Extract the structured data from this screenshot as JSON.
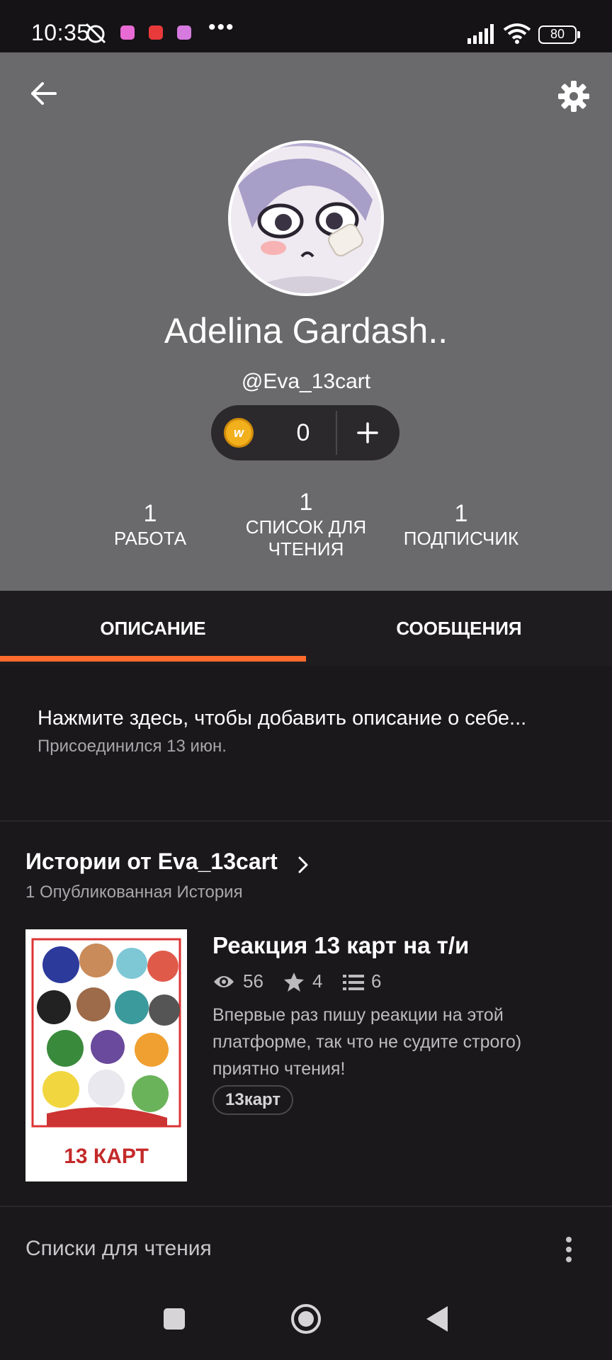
{
  "status_bar": {
    "time": "10:35",
    "battery": "80",
    "more": "•••",
    "icons": [
      "alarm-off-icon",
      "app-notification-icon",
      "yandex-icon",
      "app-icon",
      "signal-icon",
      "wifi-icon",
      "battery-icon"
    ]
  },
  "header": {
    "back_icon": "arrow-left-icon",
    "settings_icon": "gear-icon",
    "name": "Adelina Gardash..",
    "handle": "@Eva_13cart",
    "coins": {
      "icon": "wattpad-coin-icon",
      "coin_letter": "w",
      "count": "0",
      "add_icon": "plus-icon"
    },
    "stats": [
      {
        "value": "1",
        "label_lines": [
          "РАБОТА"
        ]
      },
      {
        "value": "1",
        "label_lines": [
          "СПИСОК ДЛЯ",
          "ЧТЕНИЯ"
        ]
      },
      {
        "value": "1",
        "label_lines": [
          "ПОДПИСЧИК"
        ]
      }
    ]
  },
  "tabs": [
    {
      "label": "ОПИСАНИЕ",
      "active": true
    },
    {
      "label": "СООБЩЕНИЯ",
      "active": false
    }
  ],
  "about": {
    "prompt": "Нажмите здесь, чтобы добавить описание о себе...",
    "joined": "Присоединился 13 июн."
  },
  "stories": {
    "title": "Истории от Eva_13cart",
    "subtitle": "1 Опубликованная История",
    "items": [
      {
        "title": "Реакция 13 карт на т/и",
        "reads": "56",
        "votes": "4",
        "parts": "6",
        "description": "Впервые раз пишу реакции на этой платформе, так что не судите строго) приятно чтения!",
        "tag": "13карт",
        "cover_caption": "13 КАРТ"
      }
    ]
  },
  "reading_lists": {
    "label": "Списки для чтения",
    "menu_icon": "more-vertical-icon"
  },
  "nav": {
    "icons": [
      "recents-square-icon",
      "home-circle-icon",
      "back-triangle-icon"
    ]
  },
  "colors": {
    "header_bg": "#6a696b",
    "accent": "#ff6a2e",
    "page_bg": "#1a181b",
    "coin": "#f1b01c"
  }
}
